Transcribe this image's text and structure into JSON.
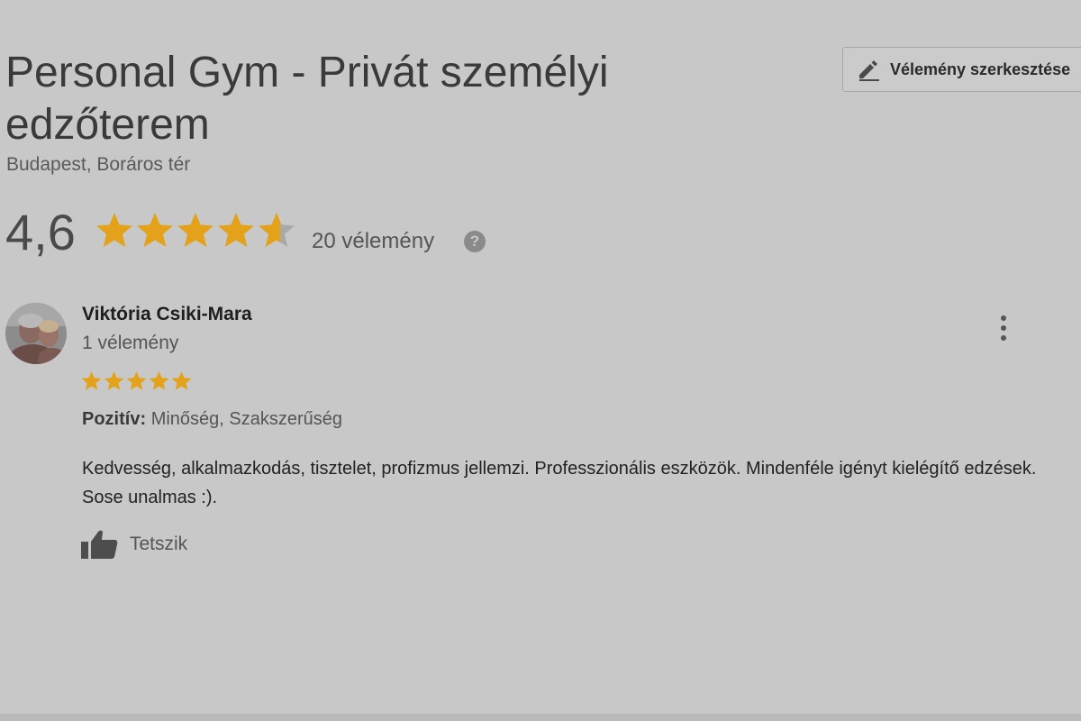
{
  "place": {
    "title": "Personal Gym - Privát személyi edzőterem",
    "address": "Budapest, Boráros tér"
  },
  "edit_button": {
    "label": "Vélemény szerkesztése",
    "icon": "pencil-icon"
  },
  "rating": {
    "value_text": "4,6",
    "value": 4.6,
    "max": 5,
    "count_label": "20 vélemény",
    "help_icon": "?"
  },
  "review": {
    "reviewer_name": "Viktória Csiki-Mara",
    "reviewer_reviews": "1 vélemény",
    "stars": 5,
    "positive_label": "Pozitív:",
    "positive_values": "Minőség, Szakszerűség",
    "text": "Kedvesség, alkalmazkodás, tisztelet, profizmus jellemzi. Professzionális eszközök. Mindenféle igényt kielégítő edzések. Sose unalmas :).",
    "like_label": "Tetszik"
  },
  "colors": {
    "star_fill": "#e3a21a",
    "star_empty": "#a9a9a9",
    "background": "#c8c8c8"
  }
}
